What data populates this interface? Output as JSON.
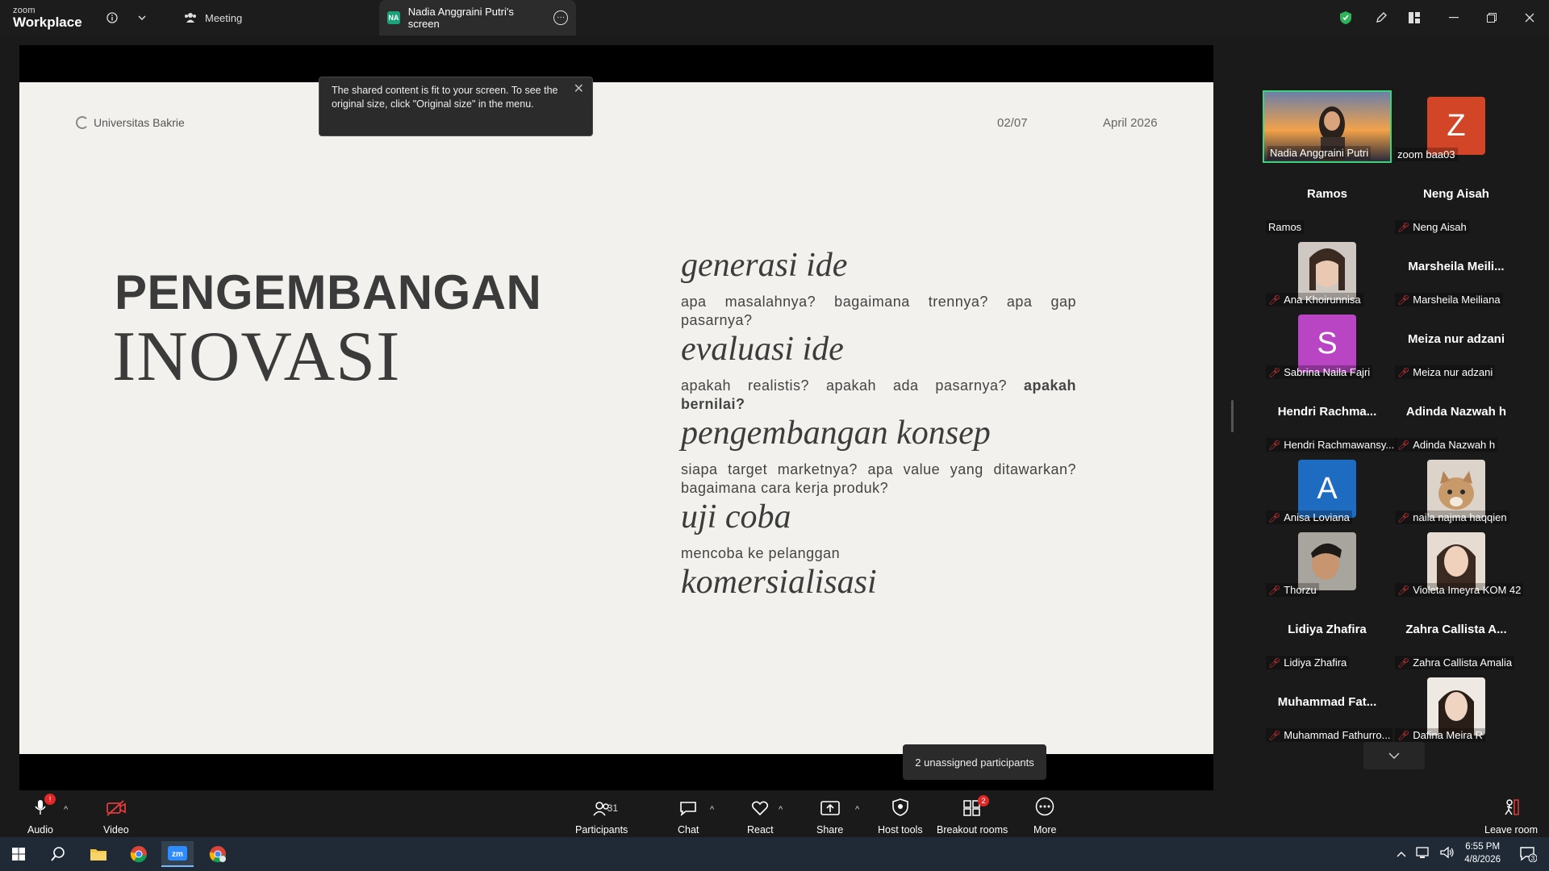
{
  "titlebar": {
    "logo_top": "zoom",
    "logo_bottom": "Workplace",
    "meeting_label": "Meeting",
    "screen_tab_badge": "NA",
    "screen_tab_label": "Nadia Anggraini Putri's screen"
  },
  "toast": {
    "text": "The shared content is fit to your screen. To see the original size, click \"Original size\" in the menu."
  },
  "slide": {
    "logo_text": "Universitas Bakrie",
    "page": "02/07",
    "date": "April 2026",
    "heading_1": "PENGEMBANGAN",
    "heading_2": "INOVASI",
    "steps": [
      {
        "title": "generasi ide",
        "desc": "apa masalahnya? bagaimana trennya? apa gap pasarnya?"
      },
      {
        "title": "evaluasi ide",
        "desc": "apakah realistis? apakah ada pasarnya?",
        "desc_bold": "apakah bernilai?"
      },
      {
        "title": "pengembangan konsep",
        "desc": "siapa target marketnya? apa value yang ditawarkan? bagaimana cara kerja produk?"
      },
      {
        "title": "uji coba",
        "desc": "mencoba ke pelanggan"
      },
      {
        "title": "komersialisasi"
      }
    ]
  },
  "gallery": {
    "tiles": [
      {
        "name": "Nadia Anggraini Putri",
        "big": ""
      },
      {
        "name": "zoom baa03",
        "big": "",
        "initial": "Z"
      },
      {
        "name": "Ramos",
        "big": "Ramos"
      },
      {
        "name": "Neng Aisah",
        "big": "Neng Aisah"
      },
      {
        "name": "Ana Khoirunnisa",
        "big": ""
      },
      {
        "name": "Marsheila Meiliana",
        "big": "Marsheila Meili..."
      },
      {
        "name": "Sabrina Naila Fajri",
        "big": "",
        "initial": "S"
      },
      {
        "name": "Meiza nur adzani",
        "big": "Meiza nur adzani"
      },
      {
        "name": "Hendri Rachmawansy...",
        "big": "Hendri Rachma..."
      },
      {
        "name": "Adinda Nazwah h",
        "big": "Adinda Nazwah h"
      },
      {
        "name": "Anisa Loviana",
        "big": "",
        "initial": "A"
      },
      {
        "name": "naila najma haqqien",
        "big": ""
      },
      {
        "name": "Thorzu",
        "big": ""
      },
      {
        "name": "Violeta Imeyra KOM 42",
        "big": ""
      },
      {
        "name": "Lidiya Zhafira",
        "big": "Lidiya Zhafira"
      },
      {
        "name": "Zahra Callista Amalia",
        "big": "Zahra Callista A..."
      },
      {
        "name": "Muhammad Fathurro...",
        "big": "Muhammad Fat..."
      },
      {
        "name": "Dafina Meira R",
        "big": ""
      }
    ]
  },
  "toolbar": {
    "audio": "Audio",
    "audio_badge": "!",
    "video": "Video",
    "participants": "Participants",
    "participants_count": "31",
    "chat": "Chat",
    "react": "React",
    "share": "Share",
    "host_tools": "Host tools",
    "breakout": "Breakout rooms",
    "breakout_badge": "2",
    "more": "More",
    "leave": "Leave room",
    "tooltip": "2 unassigned participants"
  },
  "taskbar": {
    "time": "6:55 PM",
    "date": "4/8/2026",
    "notif_count": "3"
  }
}
